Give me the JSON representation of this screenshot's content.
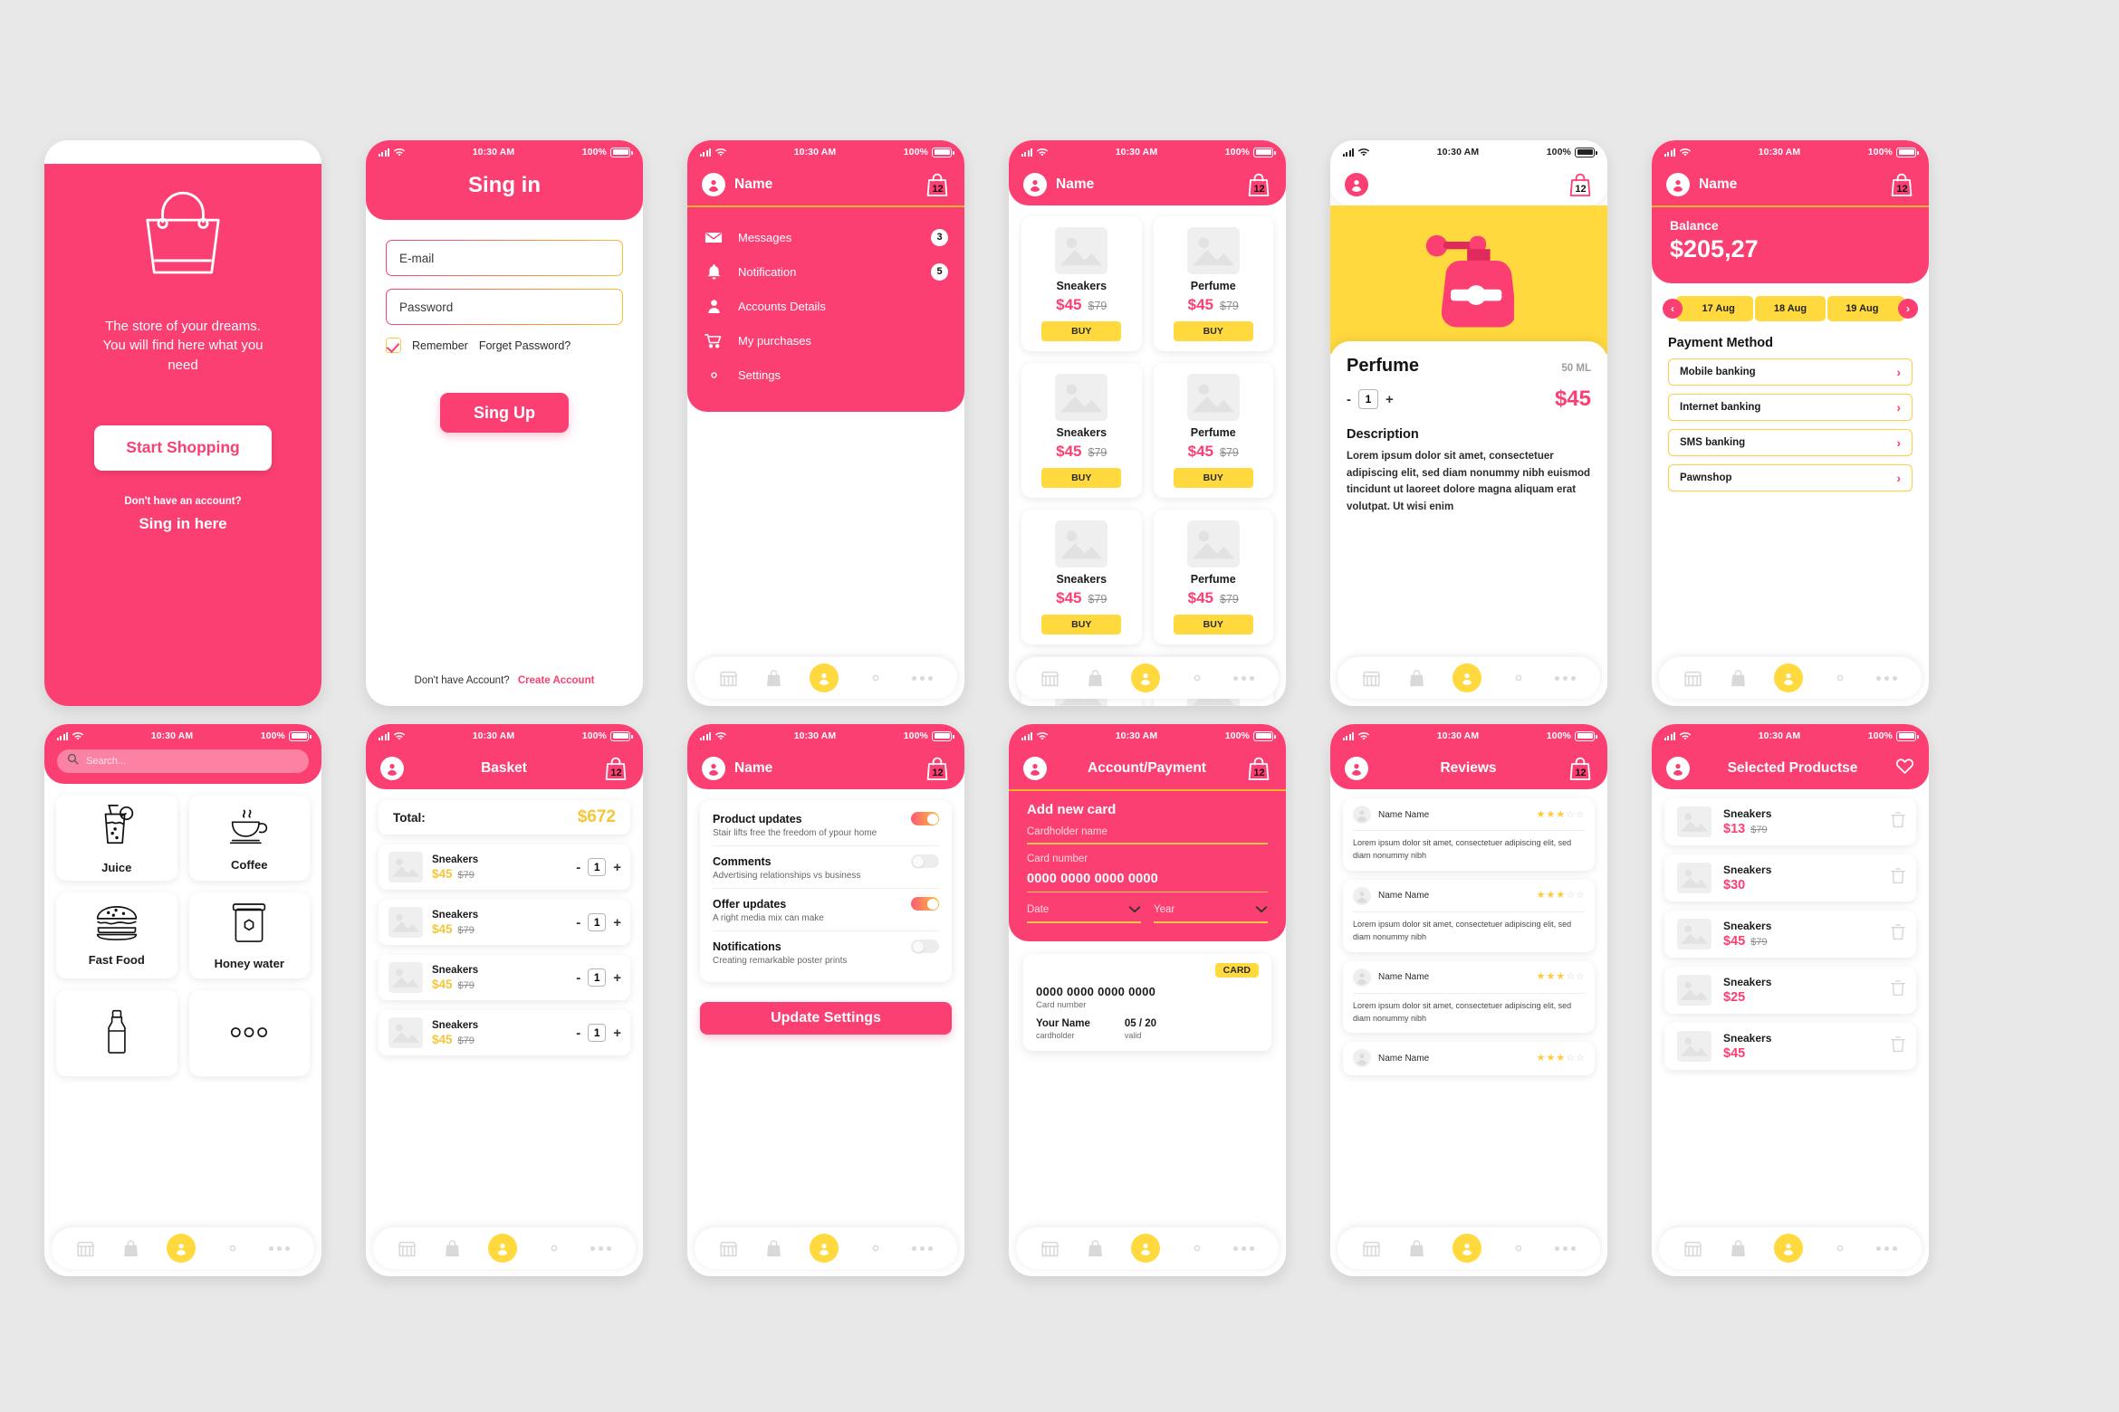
{
  "meta": {
    "status_bar": {
      "time": "10:30 AM",
      "battery": "100%"
    },
    "colors": {
      "pink": "#fb3f72",
      "yellow": "#ffd93d",
      "gold": "#f5c638",
      "grey_bg": "#e8e8e8"
    },
    "bag_badge": "12",
    "placeholder_name": "Name"
  },
  "screens": {
    "splash": {
      "tagline": "The store of your dreams. You will find here what you need",
      "start_button": "Start Shopping",
      "no_account": "Don't have an account?",
      "sign_in_here": "Sing in here"
    },
    "signin": {
      "title": "Sing in",
      "email_placeholder": "E-mail",
      "password_placeholder": "Password",
      "remember": "Remember",
      "forgot": "Forget Password?",
      "signup_button": "Sing Up",
      "no_account": "Don't have Account?",
      "create_account": "Create Account"
    },
    "menu": {
      "header_name": "Name",
      "items": [
        {
          "label": "Messages",
          "icon": "envelope-icon",
          "badge": "3"
        },
        {
          "label": "Notification",
          "icon": "bell-icon",
          "badge": "5"
        },
        {
          "label": "Accounts Details",
          "icon": "person-icon",
          "badge": ""
        },
        {
          "label": "My purchases",
          "icon": "cart-icon",
          "badge": ""
        },
        {
          "label": "Settings",
          "icon": "gear-icon",
          "badge": ""
        }
      ]
    },
    "catalog": {
      "header_name": "Name",
      "buy_label": "BUY",
      "products": [
        {
          "name": "Sneakers",
          "price": "$45",
          "old_price": "$79"
        },
        {
          "name": "Perfume",
          "price": "$45",
          "old_price": "$79"
        },
        {
          "name": "Sneakers",
          "price": "$45",
          "old_price": "$79"
        },
        {
          "name": "Perfume",
          "price": "$45",
          "old_price": "$79"
        }
      ]
    },
    "detail": {
      "name": "Perfume",
      "volume": "50 ML",
      "qty": "1",
      "minus": "-",
      "plus": "+",
      "price": "$45",
      "description_heading": "Description",
      "description": "Lorem ipsum dolor sit amet, consectetuer adipiscing elit, sed diam nonummy nibh euismod tincidunt ut laoreet dolore magna aliquam erat volutpat. Ut wisi enim"
    },
    "balance": {
      "header_name": "Name",
      "balance_label": "Balance",
      "balance_value": "$205,27",
      "dates": [
        "17 Aug",
        "18 Aug",
        "19 Aug"
      ],
      "payment_heading": "Payment Method",
      "methods": [
        "Mobile banking",
        "Internet banking",
        "SMS banking",
        "Pawnshop"
      ]
    },
    "search": {
      "placeholder": "Search...",
      "categories": [
        {
          "name": "Juice",
          "icon": "juice-glass-icon"
        },
        {
          "name": "Coffee",
          "icon": "coffee-cup-icon"
        },
        {
          "name": "Fast Food",
          "icon": "burger-icon"
        },
        {
          "name": "Honey water",
          "icon": "honey-jar-icon"
        },
        {
          "name": "",
          "icon": "bottle-icon"
        },
        {
          "name": "",
          "icon": "more-dots-icon"
        }
      ]
    },
    "basket": {
      "title": "Basket",
      "total_label": "Total:",
      "total_value": "$672",
      "items": [
        {
          "name": "Sneakers",
          "price": "$45",
          "old_price": "$79",
          "qty": "1"
        },
        {
          "name": "Sneakers",
          "price": "$45",
          "old_price": "$79",
          "qty": "1"
        },
        {
          "name": "Sneakers",
          "price": "$45",
          "old_price": "$79",
          "qty": "1"
        },
        {
          "name": "Sneakers",
          "price": "$45",
          "old_price": "$79",
          "qty": "1"
        }
      ]
    },
    "settings": {
      "header_name": "Name",
      "rows": [
        {
          "title": "Product updates",
          "sub": "Stair lifts free the freedom of ypour home",
          "on": true
        },
        {
          "title": "Comments",
          "sub": "Advertising relationships vs business",
          "on": false
        },
        {
          "title": "Offer updates",
          "sub": "A right media mix can make",
          "on": true
        },
        {
          "title": "Notifications",
          "sub": "Creating remarkable poster prints",
          "on": false
        }
      ],
      "update_button": "Update Settings"
    },
    "payment": {
      "title": "Account/Payment",
      "form_heading": "Add new card",
      "cardholder_label": "Cardholder name",
      "card_number_label": "Card number",
      "card_number_value": "0000 0000 0000 0000",
      "date_label": "Date",
      "year_label": "Year",
      "preview": {
        "tag": "CARD",
        "number": "0000 0000 0000 0000",
        "number_sub": "Card number",
        "name": "Your Name",
        "name_sub": "cardholder",
        "valid": "05 / 20",
        "valid_sub": "valid"
      }
    },
    "reviews": {
      "title": "Reviews",
      "items": [
        {
          "name": "Name Name",
          "stars": 3,
          "text": "Lorem ipsum dolor sit amet, consectetuer adipiscing elit, sed diam nonummy nibh"
        },
        {
          "name": "Name Name",
          "stars": 3,
          "text": "Lorem ipsum dolor sit amet, consectetuer adipiscing elit, sed diam nonummy nibh"
        },
        {
          "name": "Name Name",
          "stars": 3,
          "text": "Lorem ipsum dolor sit amet, consectetuer adipiscing elit, sed diam nonummy nibh"
        },
        {
          "name": "Name Name",
          "stars": 3,
          "text": ""
        }
      ]
    },
    "selected": {
      "title": "Selected Productse",
      "items": [
        {
          "name": "Sneakers",
          "price": "$13",
          "old_price": "$79"
        },
        {
          "name": "Sneakers",
          "price": "$30",
          "old_price": ""
        },
        {
          "name": "Sneakers",
          "price": "$45",
          "old_price": "$79"
        },
        {
          "name": "Sneakers",
          "price": "$25",
          "old_price": ""
        },
        {
          "name": "Sneakers",
          "price": "$45",
          "old_price": ""
        }
      ]
    }
  }
}
